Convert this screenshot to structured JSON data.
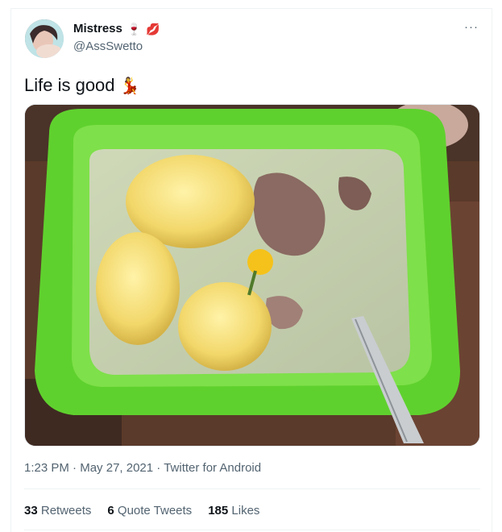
{
  "user": {
    "display_name": "Mistress",
    "emoji_1": "🍷",
    "emoji_2": "💋",
    "handle": "@AssSwetto"
  },
  "more_icon": "···",
  "tweet": {
    "text": "Life is good",
    "emoji": "💃"
  },
  "meta": {
    "time": "1:23 PM",
    "sep1": "·",
    "date": "May 27, 2021",
    "sep2": "·",
    "source": "Twitter for Android"
  },
  "stats": {
    "retweets_count": "33",
    "retweets_label": "Retweets",
    "quotes_count": "6",
    "quotes_label": "Quote Tweets",
    "likes_count": "185",
    "likes_label": "Likes"
  },
  "colors": {
    "text_primary": "#0f1419",
    "text_secondary": "#536471",
    "border": "#eff3f4",
    "bowl_green": "#5fd12e"
  }
}
